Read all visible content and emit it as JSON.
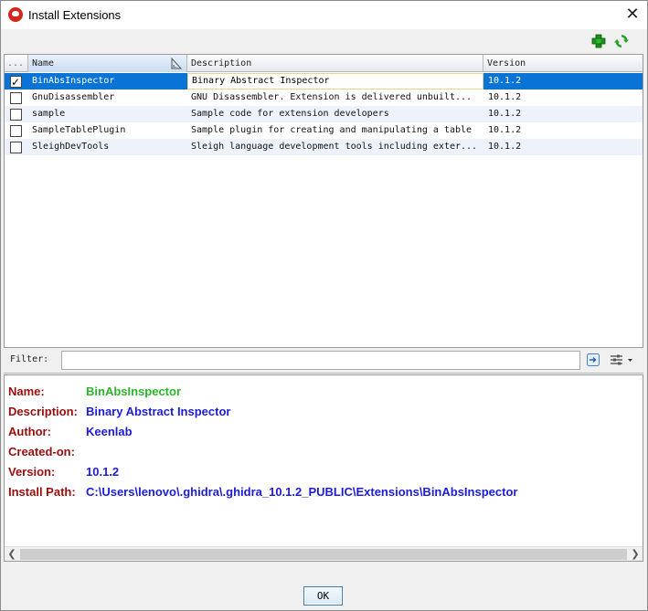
{
  "window": {
    "title": "Install Extensions",
    "close_glyph": "✕"
  },
  "toolbar": {
    "add_icon": "add-extension-icon",
    "refresh_icon": "refresh-icon"
  },
  "table": {
    "columns": {
      "check": "...",
      "name": "Name",
      "description": "Description",
      "version": "Version"
    },
    "rows": [
      {
        "checked": true,
        "name": "BinAbsInspector",
        "description": "Binary Abstract Inspector",
        "version": "10.1.2",
        "selected": true
      },
      {
        "checked": false,
        "name": "GnuDisassembler",
        "description": "GNU Disassembler.  Extension is delivered unbuilt...",
        "version": "10.1.2"
      },
      {
        "checked": false,
        "name": "sample",
        "description": "Sample code for extension developers",
        "version": "10.1.2"
      },
      {
        "checked": false,
        "name": "SampleTablePlugin",
        "description": "Sample plugin for creating and manipulating a table",
        "version": "10.1.2"
      },
      {
        "checked": false,
        "name": "SleighDevTools",
        "description": "Sleigh language development tools including exter...",
        "version": "10.1.2"
      }
    ]
  },
  "filter": {
    "label": "Filter:",
    "value": ""
  },
  "details": {
    "name_label": "Name:",
    "name_value": "BinAbsInspector",
    "description_label": "Description:",
    "description_value": "Binary Abstract Inspector",
    "author_label": "Author:",
    "author_value": "Keenlab",
    "created_label": "Created-on:",
    "created_value": "",
    "version_label": "Version:",
    "version_value": "10.1.2",
    "path_label": "Install Path:",
    "path_value": "C:\\Users\\lenovo\\.ghidra\\.ghidra_10.1.2_PUBLIC\\Extensions\\BinAbsInspector"
  },
  "colors": {
    "selected_row": "#0a74d6",
    "label_red": "#9b0d0d",
    "value_blue": "#1c1cd8",
    "name_green": "#2bb52b"
  },
  "buttons": {
    "ok": "OK"
  }
}
